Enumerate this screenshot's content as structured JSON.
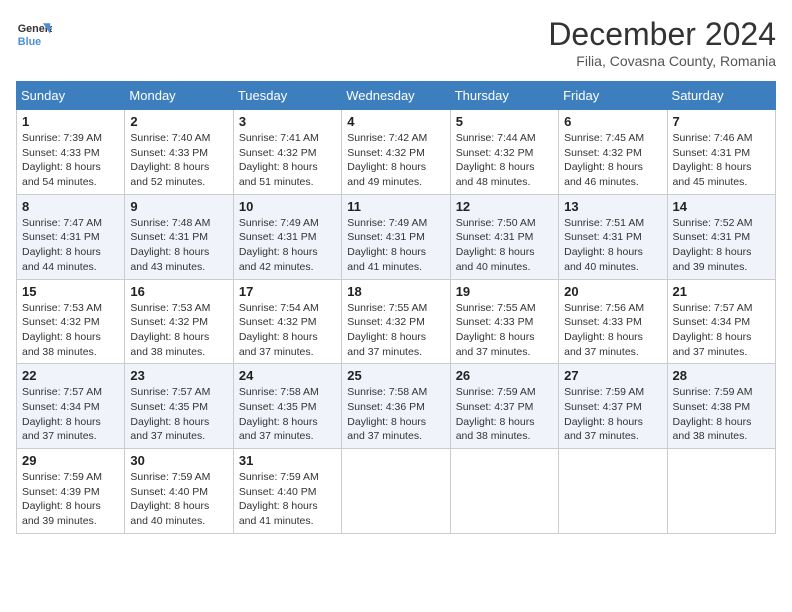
{
  "logo": {
    "line1": "General",
    "line2": "Blue"
  },
  "title": "December 2024",
  "subtitle": "Filia, Covasna County, Romania",
  "days_of_week": [
    "Sunday",
    "Monday",
    "Tuesday",
    "Wednesday",
    "Thursday",
    "Friday",
    "Saturday"
  ],
  "weeks": [
    [
      {
        "day": "1",
        "sunrise": "Sunrise: 7:39 AM",
        "sunset": "Sunset: 4:33 PM",
        "daylight": "Daylight: 8 hours and 54 minutes."
      },
      {
        "day": "2",
        "sunrise": "Sunrise: 7:40 AM",
        "sunset": "Sunset: 4:33 PM",
        "daylight": "Daylight: 8 hours and 52 minutes."
      },
      {
        "day": "3",
        "sunrise": "Sunrise: 7:41 AM",
        "sunset": "Sunset: 4:32 PM",
        "daylight": "Daylight: 8 hours and 51 minutes."
      },
      {
        "day": "4",
        "sunrise": "Sunrise: 7:42 AM",
        "sunset": "Sunset: 4:32 PM",
        "daylight": "Daylight: 8 hours and 49 minutes."
      },
      {
        "day": "5",
        "sunrise": "Sunrise: 7:44 AM",
        "sunset": "Sunset: 4:32 PM",
        "daylight": "Daylight: 8 hours and 48 minutes."
      },
      {
        "day": "6",
        "sunrise": "Sunrise: 7:45 AM",
        "sunset": "Sunset: 4:32 PM",
        "daylight": "Daylight: 8 hours and 46 minutes."
      },
      {
        "day": "7",
        "sunrise": "Sunrise: 7:46 AM",
        "sunset": "Sunset: 4:31 PM",
        "daylight": "Daylight: 8 hours and 45 minutes."
      }
    ],
    [
      {
        "day": "8",
        "sunrise": "Sunrise: 7:47 AM",
        "sunset": "Sunset: 4:31 PM",
        "daylight": "Daylight: 8 hours and 44 minutes."
      },
      {
        "day": "9",
        "sunrise": "Sunrise: 7:48 AM",
        "sunset": "Sunset: 4:31 PM",
        "daylight": "Daylight: 8 hours and 43 minutes."
      },
      {
        "day": "10",
        "sunrise": "Sunrise: 7:49 AM",
        "sunset": "Sunset: 4:31 PM",
        "daylight": "Daylight: 8 hours and 42 minutes."
      },
      {
        "day": "11",
        "sunrise": "Sunrise: 7:49 AM",
        "sunset": "Sunset: 4:31 PM",
        "daylight": "Daylight: 8 hours and 41 minutes."
      },
      {
        "day": "12",
        "sunrise": "Sunrise: 7:50 AM",
        "sunset": "Sunset: 4:31 PM",
        "daylight": "Daylight: 8 hours and 40 minutes."
      },
      {
        "day": "13",
        "sunrise": "Sunrise: 7:51 AM",
        "sunset": "Sunset: 4:31 PM",
        "daylight": "Daylight: 8 hours and 40 minutes."
      },
      {
        "day": "14",
        "sunrise": "Sunrise: 7:52 AM",
        "sunset": "Sunset: 4:31 PM",
        "daylight": "Daylight: 8 hours and 39 minutes."
      }
    ],
    [
      {
        "day": "15",
        "sunrise": "Sunrise: 7:53 AM",
        "sunset": "Sunset: 4:32 PM",
        "daylight": "Daylight: 8 hours and 38 minutes."
      },
      {
        "day": "16",
        "sunrise": "Sunrise: 7:53 AM",
        "sunset": "Sunset: 4:32 PM",
        "daylight": "Daylight: 8 hours and 38 minutes."
      },
      {
        "day": "17",
        "sunrise": "Sunrise: 7:54 AM",
        "sunset": "Sunset: 4:32 PM",
        "daylight": "Daylight: 8 hours and 37 minutes."
      },
      {
        "day": "18",
        "sunrise": "Sunrise: 7:55 AM",
        "sunset": "Sunset: 4:32 PM",
        "daylight": "Daylight: 8 hours and 37 minutes."
      },
      {
        "day": "19",
        "sunrise": "Sunrise: 7:55 AM",
        "sunset": "Sunset: 4:33 PM",
        "daylight": "Daylight: 8 hours and 37 minutes."
      },
      {
        "day": "20",
        "sunrise": "Sunrise: 7:56 AM",
        "sunset": "Sunset: 4:33 PM",
        "daylight": "Daylight: 8 hours and 37 minutes."
      },
      {
        "day": "21",
        "sunrise": "Sunrise: 7:57 AM",
        "sunset": "Sunset: 4:34 PM",
        "daylight": "Daylight: 8 hours and 37 minutes."
      }
    ],
    [
      {
        "day": "22",
        "sunrise": "Sunrise: 7:57 AM",
        "sunset": "Sunset: 4:34 PM",
        "daylight": "Daylight: 8 hours and 37 minutes."
      },
      {
        "day": "23",
        "sunrise": "Sunrise: 7:57 AM",
        "sunset": "Sunset: 4:35 PM",
        "daylight": "Daylight: 8 hours and 37 minutes."
      },
      {
        "day": "24",
        "sunrise": "Sunrise: 7:58 AM",
        "sunset": "Sunset: 4:35 PM",
        "daylight": "Daylight: 8 hours and 37 minutes."
      },
      {
        "day": "25",
        "sunrise": "Sunrise: 7:58 AM",
        "sunset": "Sunset: 4:36 PM",
        "daylight": "Daylight: 8 hours and 37 minutes."
      },
      {
        "day": "26",
        "sunrise": "Sunrise: 7:59 AM",
        "sunset": "Sunset: 4:37 PM",
        "daylight": "Daylight: 8 hours and 38 minutes."
      },
      {
        "day": "27",
        "sunrise": "Sunrise: 7:59 AM",
        "sunset": "Sunset: 4:37 PM",
        "daylight": "Daylight: 8 hours and 37 minutes."
      },
      {
        "day": "28",
        "sunrise": "Sunrise: 7:59 AM",
        "sunset": "Sunset: 4:38 PM",
        "daylight": "Daylight: 8 hours and 38 minutes."
      }
    ],
    [
      {
        "day": "29",
        "sunrise": "Sunrise: 7:59 AM",
        "sunset": "Sunset: 4:39 PM",
        "daylight": "Daylight: 8 hours and 39 minutes."
      },
      {
        "day": "30",
        "sunrise": "Sunrise: 7:59 AM",
        "sunset": "Sunset: 4:40 PM",
        "daylight": "Daylight: 8 hours and 40 minutes."
      },
      {
        "day": "31",
        "sunrise": "Sunrise: 7:59 AM",
        "sunset": "Sunset: 4:40 PM",
        "daylight": "Daylight: 8 hours and 41 minutes."
      },
      null,
      null,
      null,
      null
    ]
  ]
}
